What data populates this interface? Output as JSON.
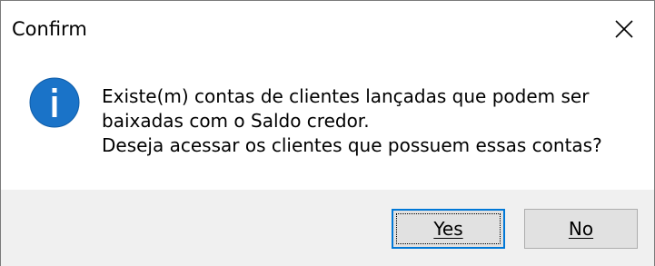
{
  "dialog": {
    "title": "Confirm",
    "close_icon": "close-icon",
    "info_icon": "info-icon",
    "info_icon_color": "#1a73c8",
    "message_lines": [
      "Existe(m) contas de clientes lançadas que podem ser",
      "baixadas com o Saldo credor.",
      "Deseja acessar os clientes que possuem essas contas?"
    ],
    "buttons": {
      "yes_label": "Yes",
      "no_label": "No"
    },
    "colors": {
      "footer_bg": "#f0f0f0",
      "default_button_border": "#0078d7"
    }
  }
}
